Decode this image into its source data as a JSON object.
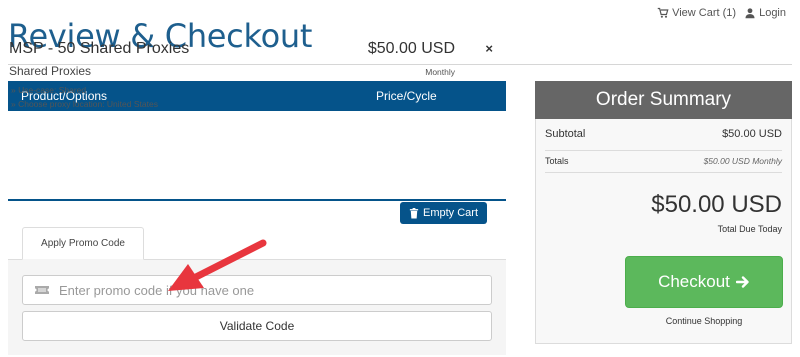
{
  "top_nav": {
    "view_cart": "View Cart (1)",
    "login": "Login"
  },
  "page": {
    "title": "Review & Checkout"
  },
  "cart": {
    "header_product": "Product/Options",
    "header_price": "Price/Cycle",
    "item": {
      "name": "MSP - 50 Shared Proxies",
      "group": "Shared Proxies",
      "options": [
        "» Use-case: Shared",
        "» Choose proxy location: United States"
      ],
      "price": "$50.00 USD",
      "cycle": "Monthly",
      "remove_icon": "×"
    },
    "empty_cart_label": "Empty Cart"
  },
  "promo": {
    "tab_label": "Apply Promo Code",
    "input_value": "",
    "input_placeholder": "Enter promo code if you have one",
    "validate_label": "Validate Code"
  },
  "summary": {
    "title": "Order Summary",
    "subtotal_label": "Subtotal",
    "subtotal_value": "$50.00 USD",
    "totals_label": "Totals",
    "totals_value": "$50.00 USD Monthly",
    "total_due_amount": "$50.00 USD",
    "total_due_label": "Total Due Today",
    "checkout_label": "Checkout",
    "continue_label": "Continue Shopping"
  },
  "icons": {
    "cart": "cart-icon",
    "user": "user-icon",
    "trash": "trash-icon",
    "ticket": "ticket-icon",
    "arrow_right": "arrow-right-icon",
    "annotation_arrow": "red-arrow-annotation"
  },
  "colors": {
    "primary": "#05538a",
    "title": "#1e5f8e",
    "summary_header": "#666666",
    "checkout": "#5cb85c",
    "annotation": "#e8363e"
  }
}
